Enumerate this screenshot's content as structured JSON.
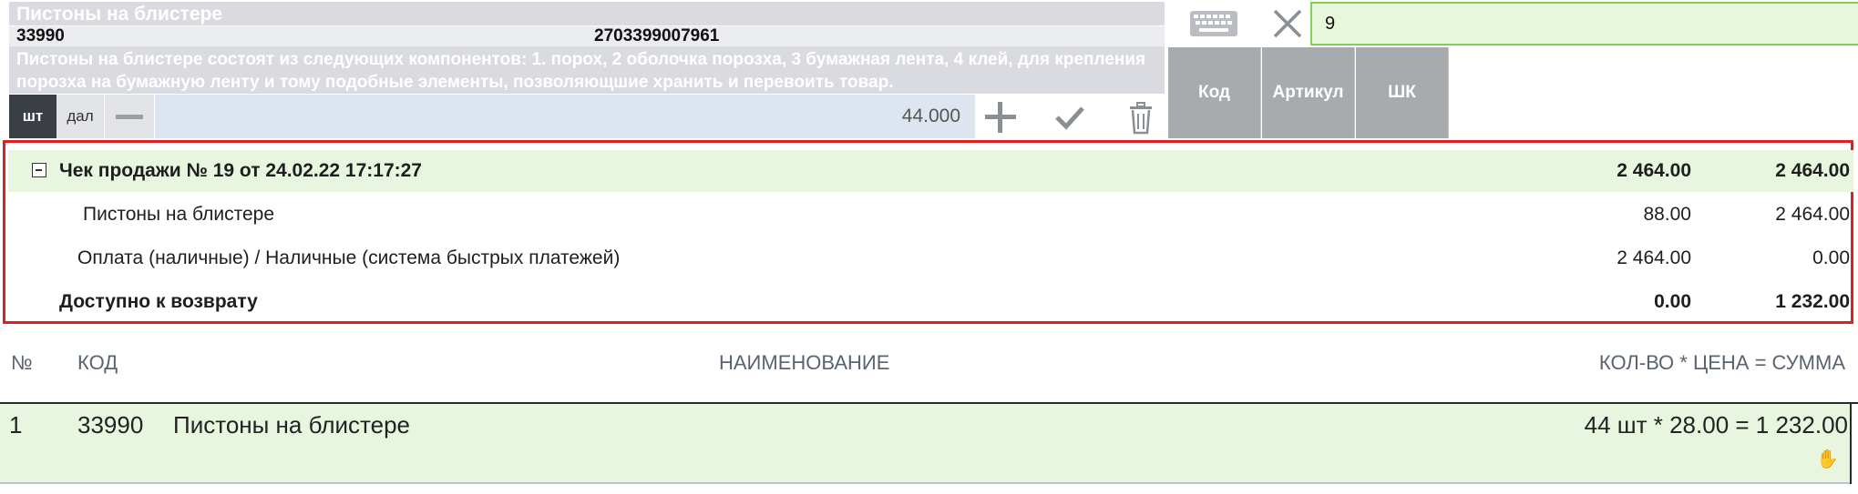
{
  "product": {
    "title": "Пистоны на блистере",
    "code": "33990",
    "barcode": "2703399007961",
    "description": "Пистоны на блистере состоят из следующих компонентов: 1. порох, 2 оболочка порозха, 3 бумажная лента, 4 клей, для крепления порозха на бумажную ленту и тому подобные элементы, позволяющшие хранить и перевоить товар."
  },
  "units": {
    "pcs": "шт",
    "dal": "дал"
  },
  "quantity": {
    "value": "44.000"
  },
  "search": {
    "value": "9"
  },
  "filters": [
    "Код",
    "Артикул",
    "ШК"
  ],
  "receipt": {
    "header": {
      "label": "Чек продажи № 19 от 24.02.22 17:17:27",
      "v1": "2 464.00",
      "v2": "2 464.00"
    },
    "item": {
      "label": "Пистоны на блистере",
      "v1": "88.00",
      "v2": "2 464.00"
    },
    "payment": {
      "label": "Оплата (наличные) / Наличные (система быстрых платежей)",
      "v1": "2 464.00",
      "v2": "0.00"
    },
    "available": {
      "label": "Доступно к возврату",
      "v1": "0.00",
      "v2": "1 232.00"
    }
  },
  "table": {
    "headers": {
      "num": "№",
      "code": "КОД",
      "name": "НАИМЕНОВАНИЕ",
      "qty": "КОЛ-ВО * ЦЕНА = СУММА"
    },
    "rows": [
      {
        "num": "1",
        "code": "33990",
        "name": "Пистоны на блистере",
        "total": "44 шт * 28.00 = 1 232.00"
      }
    ]
  },
  "icons": {
    "keyboard": "keyboard-icon",
    "clear": "close-icon",
    "minus": "minus-icon",
    "plus": "plus-icon",
    "confirm": "check-icon",
    "delete": "trash-icon",
    "collapse": "collapse-icon",
    "hand": "hand-icon"
  },
  "colors": {
    "accent_green_bg": "#e8f6e0",
    "search_border": "#7fcf5a",
    "receipt_border": "#e02020",
    "unit_active": "#3a3f45",
    "filter_tab": "#a8abad"
  }
}
